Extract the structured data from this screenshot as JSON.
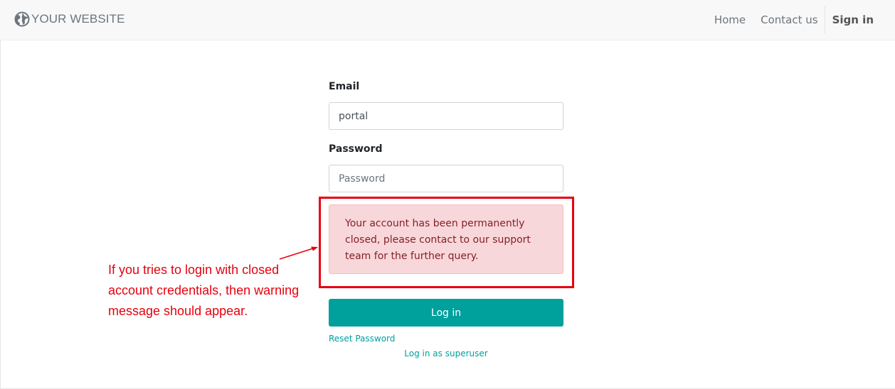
{
  "navbar": {
    "brand": "YOUR WEBSITE",
    "brand_icon": "globe-icon",
    "links": {
      "home": "Home",
      "contact": "Contact us",
      "signin": "Sign in"
    }
  },
  "form": {
    "email_label": "Email",
    "email_value": "portal",
    "password_label": "Password",
    "password_placeholder": "Password",
    "alert_message": "Your account has been permanently closed, please contact to our support team for the further query.",
    "login_button": "Log in",
    "reset_password": "Reset Password",
    "login_superuser": "Log in as superuser"
  },
  "annotation": {
    "text": "If you tries to login with closed account credentials, then warning message should appear."
  },
  "colors": {
    "accent": "#00a09d",
    "alert_bg": "#f8d7da",
    "alert_text": "#842029",
    "annotation_red": "#e8000d",
    "navbar_bg": "#f8f8f8"
  }
}
